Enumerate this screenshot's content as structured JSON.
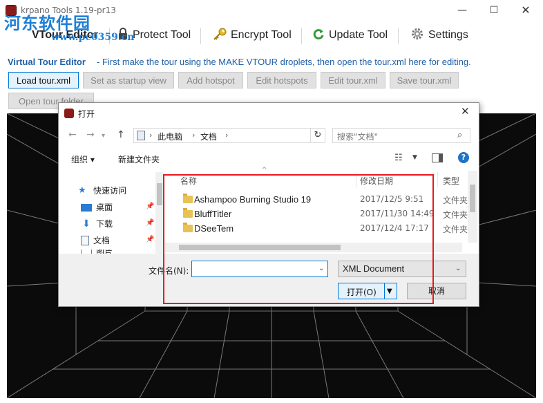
{
  "window": {
    "title": "krpano Tools 1.19-pr13",
    "min_glyph": "—",
    "max_glyph": "☐",
    "close_glyph": "✕"
  },
  "watermark": {
    "text": "河东软件园",
    "subtext": "www.pc0359.cn"
  },
  "toolbar": {
    "tabs": [
      {
        "label": "VTour Editor",
        "icon": "vtour-icon"
      },
      {
        "label": "Protect Tool",
        "icon": "lock-icon"
      },
      {
        "label": "Encrypt Tool",
        "icon": "key-icon"
      },
      {
        "label": "Update Tool",
        "icon": "refresh-icon"
      },
      {
        "label": "Settings",
        "icon": "gear-icon"
      }
    ]
  },
  "editor": {
    "title": "Virtual Tour Editor",
    "description": " - First make the tour using the MAKE VTOUR droplets, then open the tour.xml here for editing.",
    "buttons": [
      {
        "label": "Load tour.xml"
      },
      {
        "label": "Set as startup view"
      },
      {
        "label": "Add hotspot"
      },
      {
        "label": "Edit hotspots"
      },
      {
        "label": "Edit tour.xml"
      },
      {
        "label": "Save tour.xml"
      },
      {
        "label": "Open tour folder"
      }
    ]
  },
  "dialog": {
    "title": "打开",
    "close_glyph": "✕",
    "path": [
      "此电脑",
      "文档"
    ],
    "search_placeholder": "搜索\"文档\"",
    "organize_label": "组织 ▾",
    "new_folder_label": "新建文件夹",
    "nav_items": [
      {
        "label": "快速访问",
        "icon": "star-icon"
      },
      {
        "label": "桌面",
        "icon": "desktop-icon",
        "pinned": true
      },
      {
        "label": "下载",
        "icon": "download-icon",
        "pinned": true
      },
      {
        "label": "文档",
        "icon": "document-icon",
        "pinned": true
      },
      {
        "label": "图片",
        "icon": "picture-icon",
        "pinned": true
      }
    ],
    "columns": {
      "name": "名称",
      "date": "修改日期",
      "type": "类型"
    },
    "files": [
      {
        "name": "Ashampoo Burning Studio 19",
        "date": "2017/12/5 9:51",
        "type": "文件夹"
      },
      {
        "name": "BluffTitler",
        "date": "2017/11/30 14:49",
        "type": "文件夹"
      },
      {
        "name": "DSeeTem",
        "date": "2017/12/4 17:17",
        "type": "文件夹"
      }
    ],
    "filename_label": "文件名(N):",
    "filename_value": "",
    "filetype_value": "XML Document",
    "open_label": "打开(O)",
    "cancel_label": "取消"
  },
  "colors": {
    "accent": "#0078d7",
    "editor_text": "#1f5fa6",
    "highlight_box": "#e8191e"
  }
}
